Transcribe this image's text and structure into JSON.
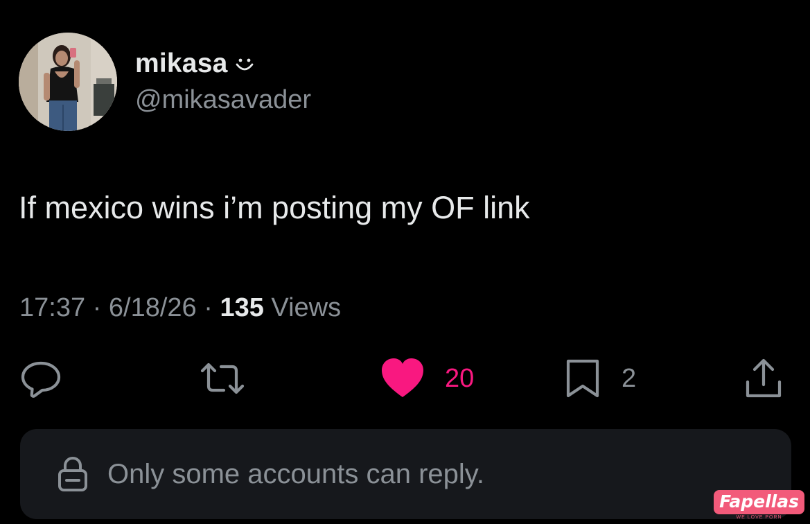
{
  "author": {
    "display_name": "mikasa",
    "handle": "@mikasavader",
    "avatar_icon": "profile-photo",
    "name_emoji_icon": "smiley-icon"
  },
  "tweet": {
    "text": "If mexico wins i’m posting my OF link",
    "time": "17:37",
    "separator": " · ",
    "date": "6/18/26",
    "views_count": "135",
    "views_label": " Views"
  },
  "actions": {
    "reply_icon": "reply-icon",
    "repost_icon": "repost-icon",
    "like_icon": "heart-icon",
    "like_count": "20",
    "bookmark_icon": "bookmark-icon",
    "bookmark_count": "2",
    "share_icon": "share-icon"
  },
  "reply_restriction": {
    "icon": "lock-icon",
    "text": "Only some accounts can reply."
  },
  "watermark": {
    "brand": "Fapellas",
    "tagline": "WE LOVE PORN"
  },
  "colors": {
    "background": "#000000",
    "primary_text": "#e7e9ea",
    "secondary_text": "#8b9197",
    "like_pink": "#f91880",
    "restriction_bg": "#16181c",
    "watermark_pink": "#f25a7a"
  }
}
